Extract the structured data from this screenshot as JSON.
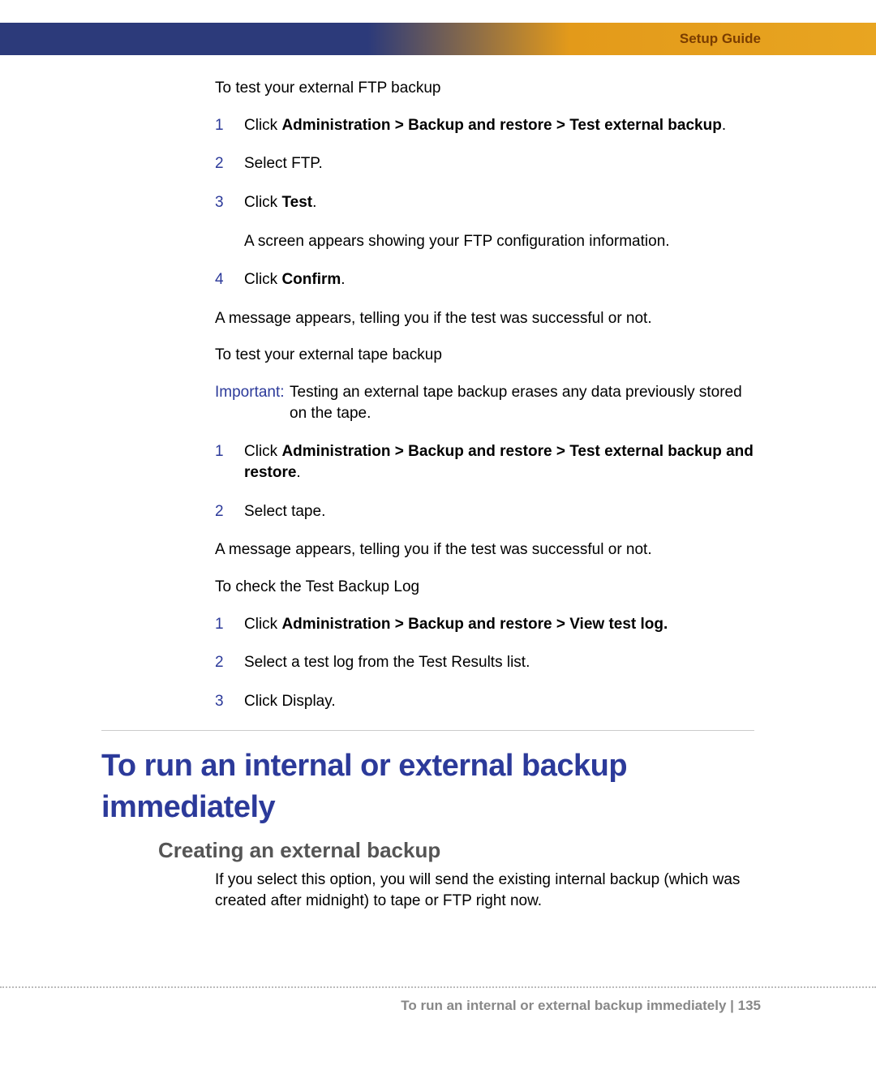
{
  "header": {
    "label": "Setup Guide"
  },
  "body": {
    "intro_ftp": "To test your external FTP backup",
    "steps_ftp": [
      {
        "n": "1",
        "pre": "Click ",
        "bold": "Administration > Backup and restore > Test external backup",
        "post": "."
      },
      {
        "n": "2",
        "text": "Select FTP."
      },
      {
        "n": "3",
        "pre": "Click ",
        "bold": "Test",
        "post": ".",
        "sub": "A screen appears showing your FTP configuration information."
      },
      {
        "n": "4",
        "pre": "Click ",
        "bold": "Confirm",
        "post": "."
      }
    ],
    "msg_success_1": "A message appears, telling you if the test was successful or not.",
    "intro_tape": "To test your external tape backup",
    "important_label": "Important:",
    "important_text": "Testing an external tape backup erases any data previously stored on the tape.",
    "steps_tape": [
      {
        "n": "1",
        "pre": "Click ",
        "bold": "Administration > Backup and restore > Test external backup and restore",
        "post": "."
      },
      {
        "n": "2",
        "text": "Select tape."
      }
    ],
    "msg_success_2": "A message appears, telling you if the test was successful or not.",
    "intro_log": "To check the Test Backup Log",
    "steps_log": [
      {
        "n": "1",
        "pre": "Click ",
        "bold": "Administration > Backup and restore > View test log.",
        "post": ""
      },
      {
        "n": "2",
        "text": "Select a test log from the Test Results list."
      },
      {
        "n": "3",
        "text": "Click Display."
      }
    ],
    "h1": "To run an internal or external backup immediately",
    "h2": "Creating an external backup",
    "h2_para": "If you select this option, you will send the existing internal backup (which was created after midnight) to tape or FTP right now."
  },
  "footer": {
    "text": "To run an internal or external backup immediately | 135"
  }
}
